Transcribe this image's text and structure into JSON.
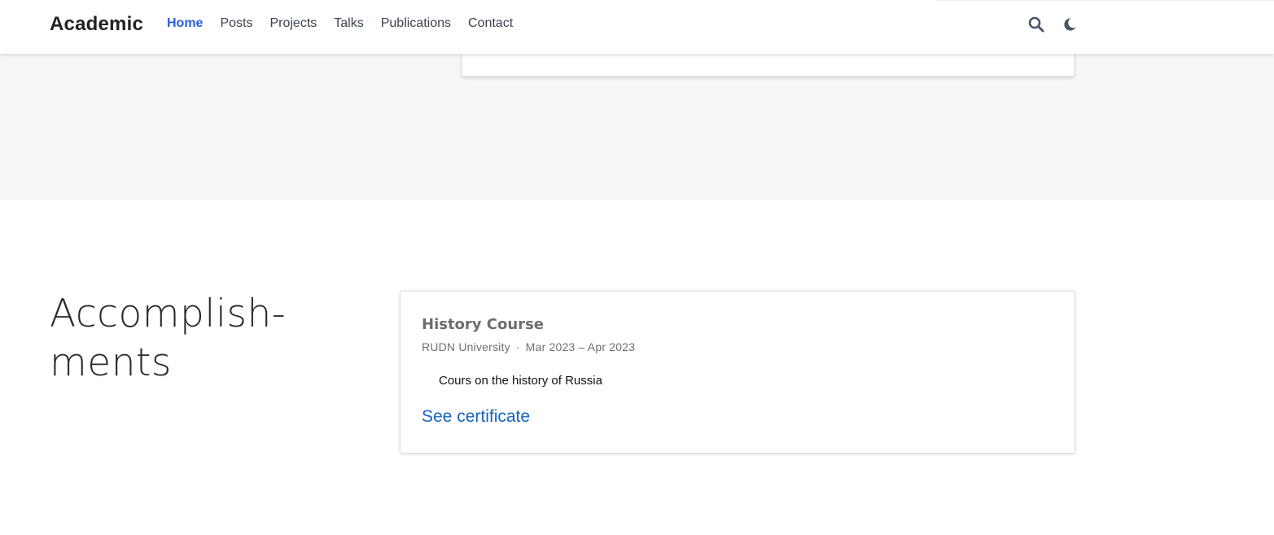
{
  "navbar": {
    "brand": "Academic",
    "links": [
      {
        "label": "Home",
        "active": true
      },
      {
        "label": "Posts",
        "active": false
      },
      {
        "label": "Projects",
        "active": false
      },
      {
        "label": "Talks",
        "active": false
      },
      {
        "label": "Publications",
        "active": false
      },
      {
        "label": "Contact",
        "active": false
      }
    ],
    "icons": [
      "search-icon",
      "moon-icon"
    ]
  },
  "accomplishments": {
    "title_line1": "Accomplish-",
    "title_line2": "ments",
    "items": [
      {
        "title": "History Course",
        "organization": "RUDN University",
        "separator": "·",
        "date_range": "Mar 2023 – Apr 2023",
        "description": "Cours on the history of Russia",
        "link_label": "See certificate"
      }
    ]
  },
  "colors": {
    "accent": "#2962d9",
    "link": "#1565c0",
    "section_bg": "#f6f6f6",
    "icon": "#4a5568"
  }
}
